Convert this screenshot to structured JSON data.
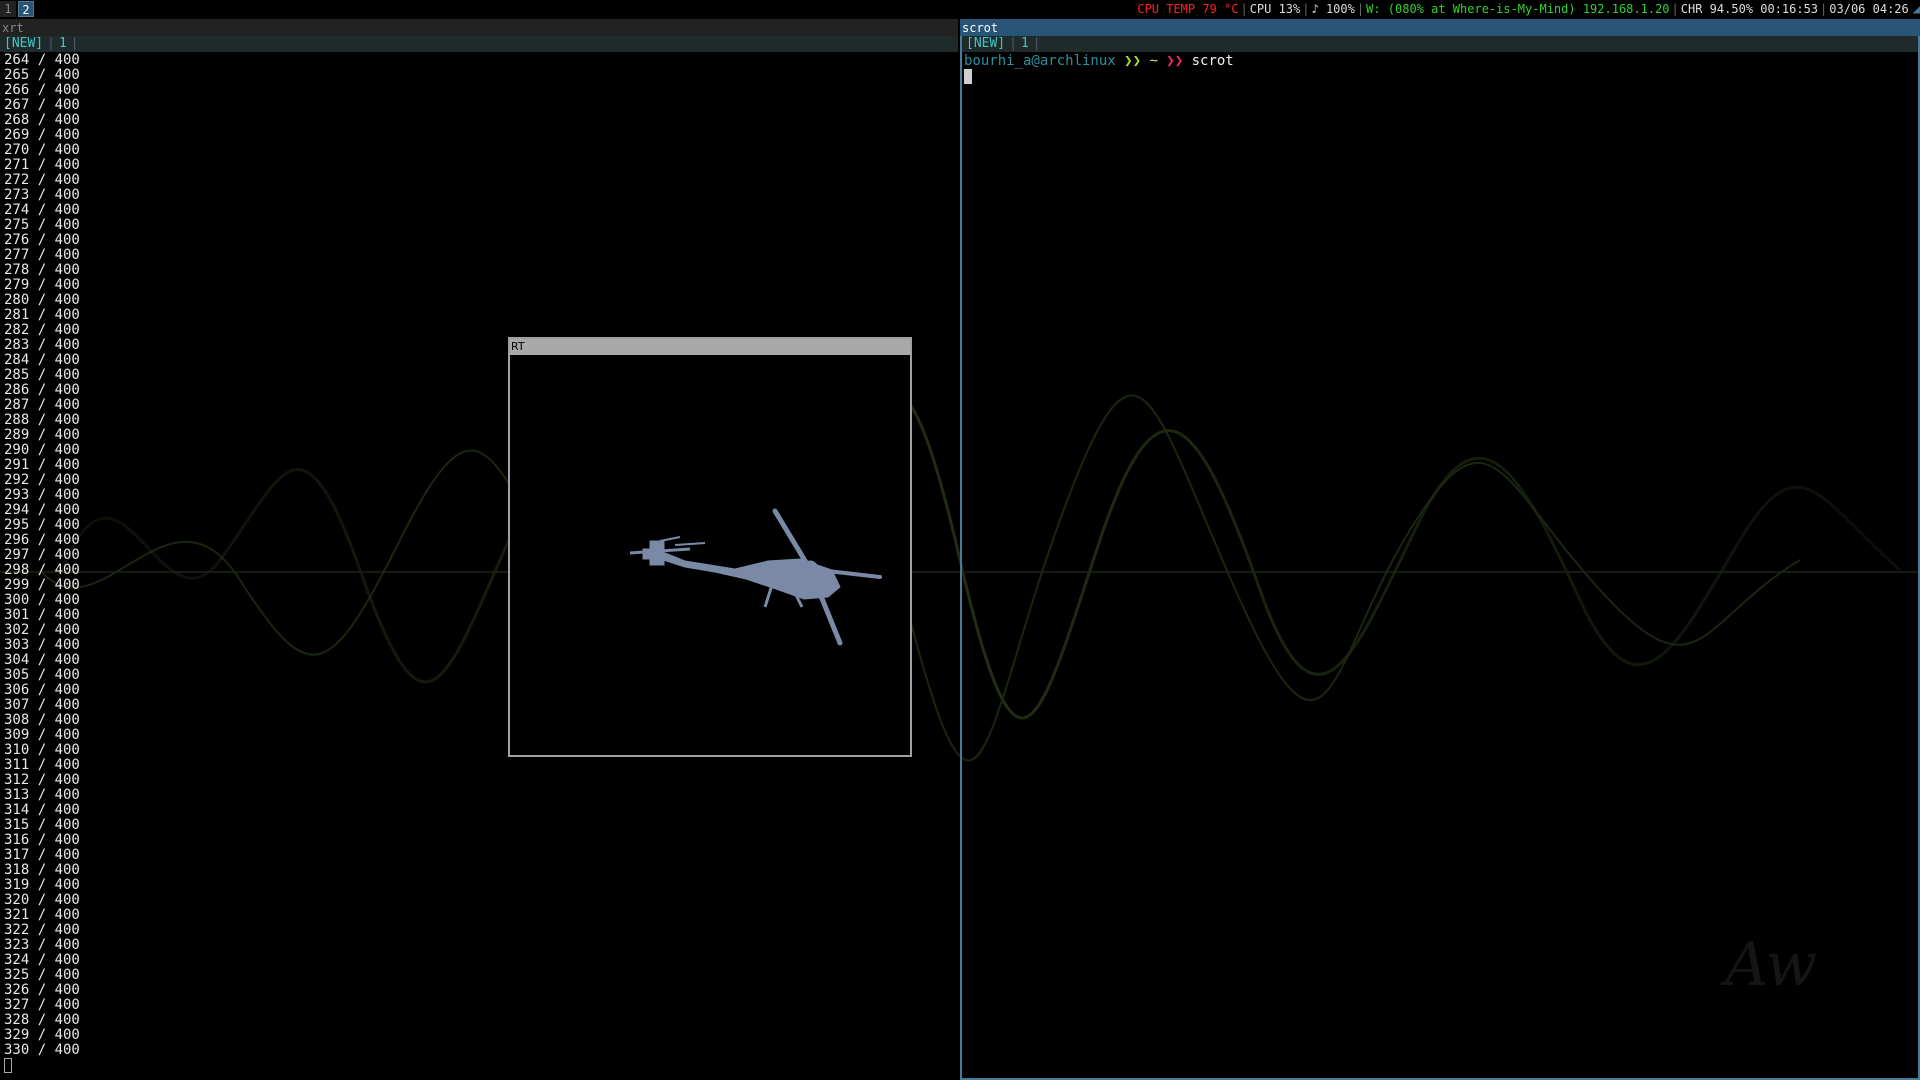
{
  "workspaces": [
    "1",
    "2"
  ],
  "status": {
    "cpu_temp": "CPU TEMP 79 °C",
    "cpu": "CPU 13%",
    "volume": "♪ 100%",
    "wifi": "W: (080% at Where-is-My-Mind) 192.168.1.20",
    "battery": "CHR 94.50% 00:16:53",
    "datetime": "03/06 04:26",
    "colors": {
      "temp": "#ff2020",
      "wifi": "#2ed22e",
      "normal": "#e0e0e0"
    }
  },
  "left_window": {
    "title": "xrt",
    "tab_new": "[NEW]",
    "tab_num": "1",
    "progress_lines": [
      "264 / 400",
      "265 / 400",
      "266 / 400",
      "267 / 400",
      "268 / 400",
      "269 / 400",
      "270 / 400",
      "271 / 400",
      "272 / 400",
      "273 / 400",
      "274 / 400",
      "275 / 400",
      "276 / 400",
      "277 / 400",
      "278 / 400",
      "279 / 400",
      "280 / 400",
      "281 / 400",
      "282 / 400",
      "283 / 400",
      "284 / 400",
      "285 / 400",
      "286 / 400",
      "287 / 400",
      "288 / 400",
      "289 / 400",
      "290 / 400",
      "291 / 400",
      "292 / 400",
      "293 / 400",
      "294 / 400",
      "295 / 400",
      "296 / 400",
      "297 / 400",
      "298 / 400",
      "299 / 400",
      "300 / 400",
      "301 / 400",
      "302 / 400",
      "303 / 400",
      "304 / 400",
      "305 / 400",
      "306 / 400",
      "307 / 400",
      "308 / 400",
      "309 / 400",
      "310 / 400",
      "311 / 400",
      "312 / 400",
      "313 / 400",
      "314 / 400",
      "315 / 400",
      "316 / 400",
      "317 / 400",
      "318 / 400",
      "319 / 400",
      "320 / 400",
      "321 / 400",
      "322 / 400",
      "323 / 400",
      "324 / 400",
      "325 / 400",
      "326 / 400",
      "327 / 400",
      "328 / 400",
      "329 / 400",
      "330 / 400"
    ]
  },
  "right_window": {
    "title": "scrot",
    "tab_new": "[NEW]",
    "tab_num": "1",
    "prompt_user": "bourhi_a@archlinux",
    "prompt_arrow1": " ❯❯ ",
    "prompt_dir": "~",
    "prompt_arrow2": " ❯❯ ",
    "command": "scrot"
  },
  "rt_window": {
    "title": "RT",
    "icon": "helicopter-silhouette-render"
  }
}
